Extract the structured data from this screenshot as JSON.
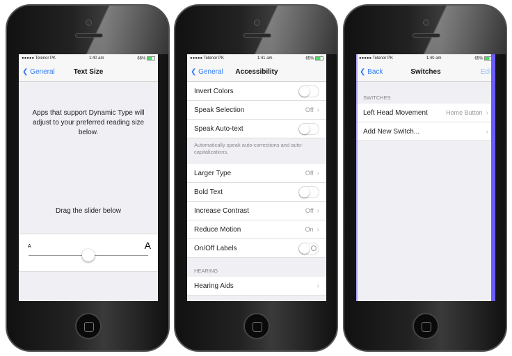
{
  "status": [
    {
      "carrier": "●●●●● Telenor PK",
      "time": "1:40 am",
      "battery": "66%"
    },
    {
      "carrier": "●●●●● Telenor PK",
      "time": "1:41 am",
      "battery": "65%"
    },
    {
      "carrier": "●●●●● Telenor PK",
      "time": "1:40 am",
      "battery": "65%"
    }
  ],
  "text_size": {
    "back": "General",
    "title": "Text Size",
    "description": "Apps that support Dynamic Type will adjust to your preferred reading size below.",
    "hint": "Drag the slider below",
    "small_a": "A",
    "large_a": "A",
    "slider_value": 0.5
  },
  "accessibility": {
    "back": "General",
    "title": "Accessibility",
    "group1": [
      {
        "label": "Invert Colors",
        "type": "toggle"
      },
      {
        "label": "Speak Selection",
        "value": "Off"
      },
      {
        "label": "Speak Auto-text",
        "type": "toggle"
      }
    ],
    "footer": "Automatically speak auto-corrections and auto-capitalizations.",
    "group2": [
      {
        "label": "Larger Type",
        "value": "Off"
      },
      {
        "label": "Bold Text",
        "type": "toggle"
      },
      {
        "label": "Increase Contrast",
        "value": "Off"
      },
      {
        "label": "Reduce Motion",
        "value": "On"
      },
      {
        "label": "On/Off Labels",
        "type": "toggle"
      }
    ],
    "hearing_header": "HEARING",
    "hearing": [
      {
        "label": "Hearing Aids"
      }
    ]
  },
  "switches": {
    "back": "Back",
    "title": "Switches",
    "edit": "Edit",
    "header": "SWITCHES",
    "rows": [
      {
        "label": "Left Head Movement",
        "value": "Home Button"
      },
      {
        "label": "Add New Switch..."
      }
    ]
  },
  "colors": {
    "accent": "#2f7cf6",
    "highlight": "#6a5cff"
  }
}
